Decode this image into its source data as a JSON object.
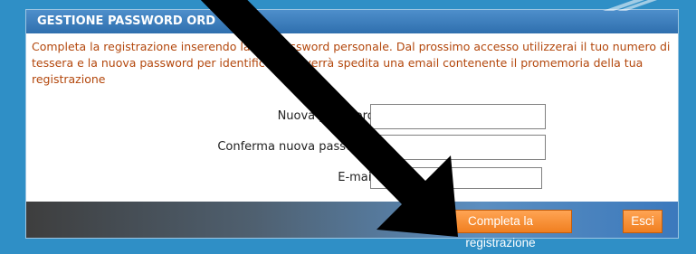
{
  "panel": {
    "title": "GESTIONE PASSWORD ORD",
    "intro": "Completa la registrazione inserendo la tua password personale. Dal prossimo accesso utilizzerai il tuo numero di tessera e la nuova password per identificarti. Ti verrà spedita una email contenente il promemoria della tua registrazione"
  },
  "form": {
    "new_password_label": "Nuova password",
    "new_password_value": "",
    "confirm_password_label": "Conferma nuova password",
    "confirm_password_value": "",
    "email_label": "E-mail",
    "email_value": ""
  },
  "buttons": {
    "complete_label": "Completa la registrazione",
    "exit_label": "Esci"
  },
  "colors": {
    "page_background": "#2f8fc6",
    "header": "#2f6fae",
    "intro_text": "#b3470c",
    "button": "#f07f20"
  }
}
